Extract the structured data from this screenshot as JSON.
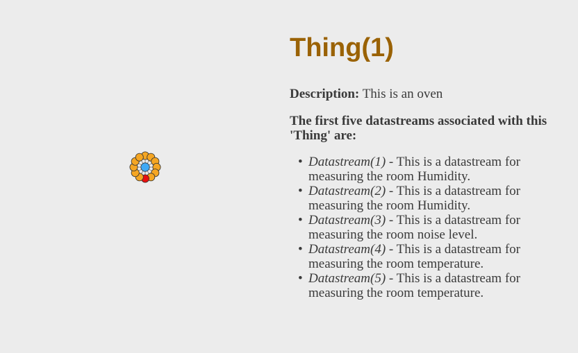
{
  "thing": {
    "title": "Thing(1)",
    "description_label": "Description:",
    "description": "This is an oven"
  },
  "datastreams": {
    "heading": "The first five datastreams associated with this 'Thing' are:",
    "items": [
      {
        "name": "Datastream(1)",
        "text": "- This is a datastream for measuring the room Humidity."
      },
      {
        "name": "Datastream(2)",
        "text": "- This is a datastream for measuring the room Humidity."
      },
      {
        "name": "Datastream(3)",
        "text": "- This is a datastream for measuring the room noise level."
      },
      {
        "name": "Datastream(4)",
        "text": "- This is a datastream for measuring the room temperature."
      },
      {
        "name": "Datastream(5)",
        "text": "- This is a datastream for measuring the room temperature."
      }
    ]
  },
  "graph": {
    "center_node_color": "#3fa9f5",
    "datastream_node_color": "#f5a623",
    "selected_node_color": "#e8100f",
    "node_outline_color": "#333333",
    "node_count": 12,
    "selected_index": 6
  },
  "colors": {
    "title": "#9a6205",
    "text": "#3a3a3a",
    "background": "#ececec"
  }
}
